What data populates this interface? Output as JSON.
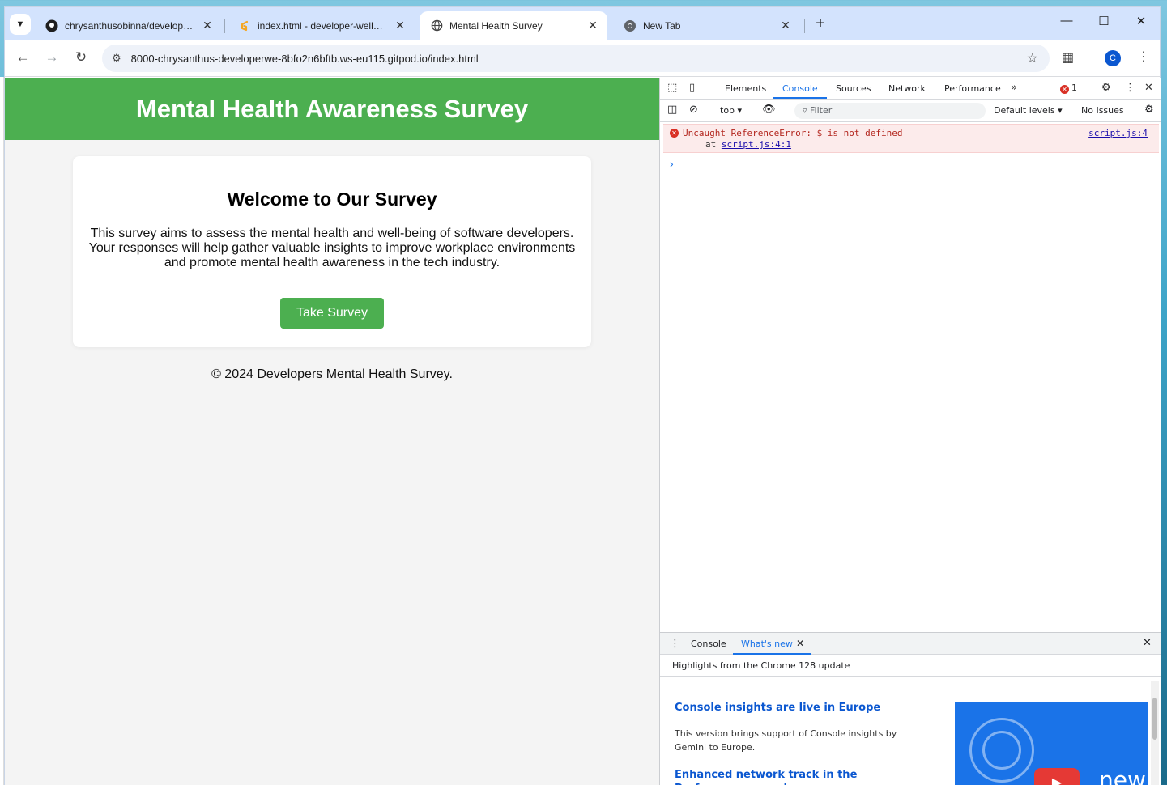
{
  "browser": {
    "tabs": [
      {
        "title": "chrysanthusobinna/developer-w",
        "icon": "github-icon",
        "active": false
      },
      {
        "title": "index.html - developer-wellness",
        "icon": "gitpod-icon",
        "active": false
      },
      {
        "title": "Mental Health Survey",
        "icon": "globe-icon",
        "active": true
      },
      {
        "title": "New Tab",
        "icon": "chrome-icon",
        "active": false
      }
    ],
    "url": "8000-chrysanthus-developerwe-8bfo2n6bftb.ws-eu115.gitpod.io/index.html",
    "profile_initial": "C"
  },
  "page": {
    "header_title": "Mental Health Awareness Survey",
    "card": {
      "heading": "Welcome to Our Survey",
      "body": "This survey aims to assess the mental health and well-being of software developers. Your responses will help gather valuable insights to improve workplace environments and promote mental health awareness in the tech industry.",
      "button_label": "Take Survey"
    },
    "footer": "© 2024 Developers Mental Health Survey.",
    "accent_color": "#4caf50"
  },
  "devtools": {
    "tabs": [
      "Elements",
      "Console",
      "Sources",
      "Network",
      "Performance"
    ],
    "active_tab": "Console",
    "error_count": "1",
    "context": "top",
    "filter_placeholder": "Filter",
    "levels": "Default levels",
    "issues": "No Issues",
    "console": {
      "error_message": "Uncaught ReferenceError: $ is not defined",
      "error_at_prefix": "at",
      "error_at_link": "script.js:4:1",
      "error_source": "script.js:4"
    },
    "drawer": {
      "tabs": [
        "Console",
        "What's new"
      ],
      "active_tab": "What's new",
      "subtitle": "Highlights from the Chrome 128 update",
      "items": [
        {
          "heading": "Console insights are live in Europe",
          "body": "This version brings support of Console insights by Gemini to Europe."
        },
        {
          "heading": "Enhanced network track in the Performance panel",
          "body": ""
        }
      ],
      "image_text": "new"
    }
  }
}
